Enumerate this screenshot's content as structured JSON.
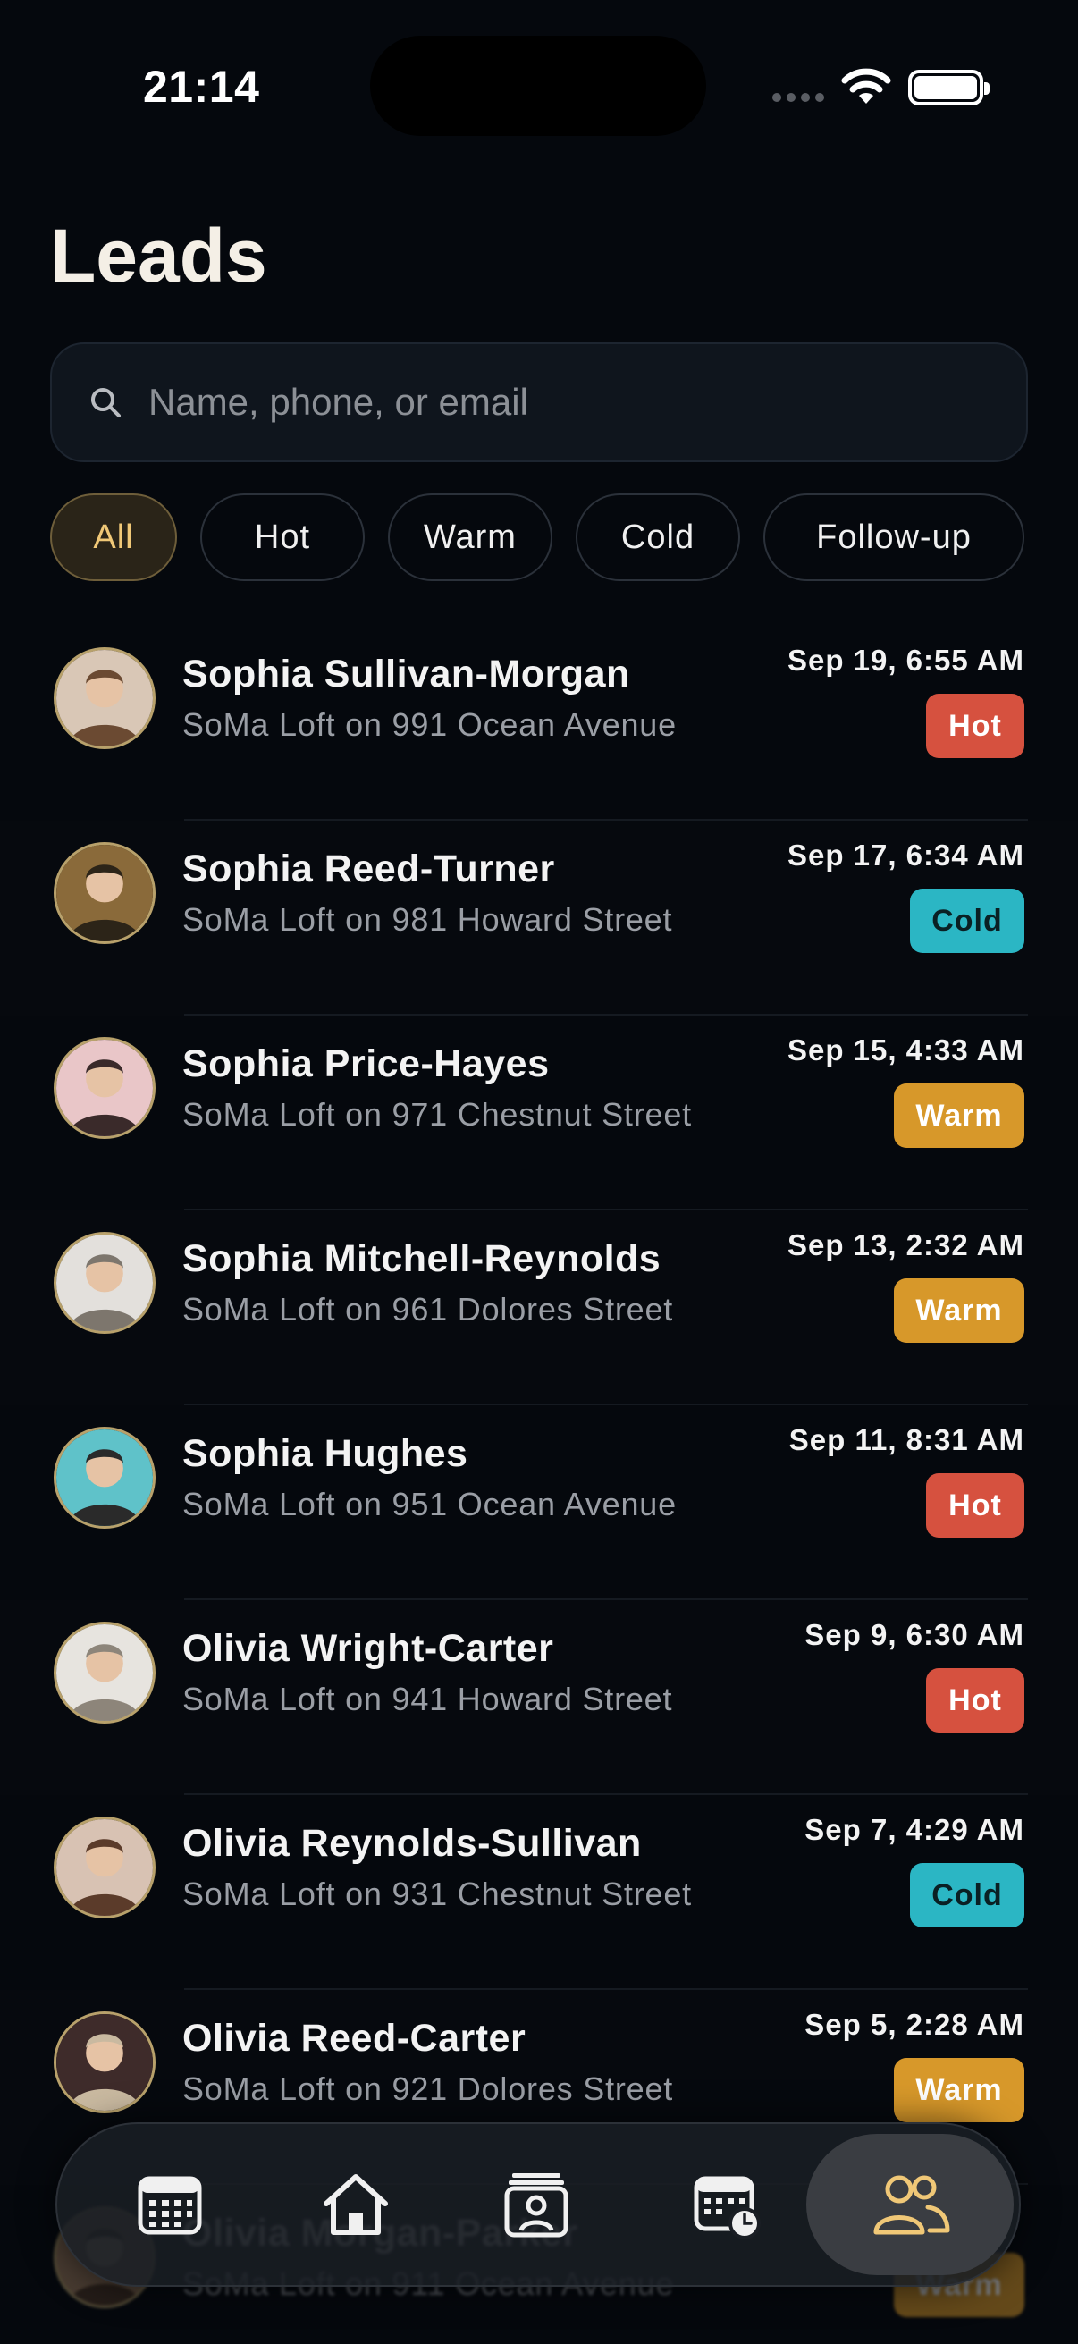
{
  "status": {
    "time": "21:14"
  },
  "header": {
    "title": "Leads"
  },
  "search": {
    "placeholder": "Name, phone, or email"
  },
  "filters": [
    {
      "label": "All",
      "active": true
    },
    {
      "label": "Hot",
      "active": false
    },
    {
      "label": "Warm",
      "active": false
    },
    {
      "label": "Cold",
      "active": false
    },
    {
      "label": "Follow-up",
      "active": false
    }
  ],
  "leads": [
    {
      "name": "Sophia Sullivan-Morgan",
      "property": "SoMa Loft on 991 Ocean Avenue",
      "date": "Sep 19, 6:55 AM",
      "status": "Hot"
    },
    {
      "name": "Sophia Reed-Turner",
      "property": "SoMa Loft on 981 Howard Street",
      "date": "Sep 17, 6:34 AM",
      "status": "Cold"
    },
    {
      "name": "Sophia Price-Hayes",
      "property": "SoMa Loft on 971 Chestnut Street",
      "date": "Sep 15, 4:33 AM",
      "status": "Warm"
    },
    {
      "name": "Sophia Mitchell-Reynolds",
      "property": "SoMa Loft on 961 Dolores Street",
      "date": "Sep 13, 2:32 AM",
      "status": "Warm"
    },
    {
      "name": "Sophia Hughes",
      "property": "SoMa Loft on 951 Ocean Avenue",
      "date": "Sep 11, 8:31 AM",
      "status": "Hot"
    },
    {
      "name": "Olivia Wright-Carter",
      "property": "SoMa Loft on 941 Howard Street",
      "date": "Sep 9, 6:30 AM",
      "status": "Hot"
    },
    {
      "name": "Olivia Reynolds-Sullivan",
      "property": "SoMa Loft on 931 Chestnut Street",
      "date": "Sep 7, 4:29 AM",
      "status": "Cold"
    },
    {
      "name": "Olivia Reed-Carter",
      "property": "SoMa Loft on 921 Dolores Street",
      "date": "Sep 5, 2:28 AM",
      "status": "Warm"
    },
    {
      "name": "Olivia Morgan-Parker",
      "property": "SoMa Loft on 911 Ocean Avenue",
      "date": "",
      "status": "Warm"
    }
  ],
  "tabs": [
    {
      "icon": "calendar-icon",
      "active": false
    },
    {
      "icon": "home-icon",
      "active": false
    },
    {
      "icon": "contact-card-icon",
      "active": false
    },
    {
      "icon": "calendar-clock-icon",
      "active": false
    },
    {
      "icon": "people-icon",
      "active": true
    }
  ],
  "colors": {
    "hot": "#d6513f",
    "cold": "#2bb6c4",
    "warm": "#d7982a",
    "accent": "#f0c877"
  }
}
